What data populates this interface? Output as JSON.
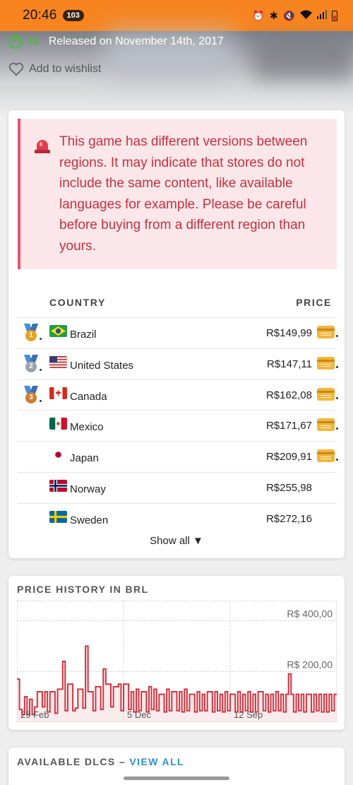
{
  "status_bar": {
    "time": "20:46",
    "notification_count": "103",
    "icons": [
      "alarm-icon",
      "bluetooth-icon",
      "mute-icon",
      "wifi-icon",
      "signal-icon",
      "battery-icon"
    ],
    "bg_color": "#f7841f"
  },
  "game": {
    "score": "76",
    "release_text": "Released on November 14th, 2017",
    "wishlist_label": "Add to wishlist"
  },
  "alert": {
    "text": "This game has different versions between regions. It may indicate that stores do not include the same content, like available languages for example. Please be careful before buying from a different region than yours.",
    "icon": "siren-icon",
    "color": "#c8303f"
  },
  "price_table": {
    "col_country": "COUNTRY",
    "col_price": "PRICE",
    "rows": [
      {
        "rank": "1",
        "medal_color": "#e8a21f",
        "flag": "brazil",
        "country": "Brazil",
        "price": "R$149,99",
        "card": true
      },
      {
        "rank": "2",
        "medal_color": "#9aa3ad",
        "flag": "united-states",
        "country": "United States",
        "price": "R$147,11",
        "card": true
      },
      {
        "rank": "3",
        "medal_color": "#d07a32",
        "flag": "canada",
        "country": "Canada",
        "price": "R$162,08",
        "card": true
      },
      {
        "rank": "",
        "flag": "mexico",
        "country": "Mexico",
        "price": "R$171,67",
        "card": true
      },
      {
        "rank": "",
        "flag": "japan",
        "country": "Japan",
        "price": "R$209,91",
        "card": true
      },
      {
        "rank": "",
        "flag": "norway",
        "country": "Norway",
        "price": "R$255,98",
        "card": false
      },
      {
        "rank": "",
        "flag": "sweden",
        "country": "Sweden",
        "price": "R$272,16",
        "card": false
      }
    ],
    "show_all": "Show all ▼"
  },
  "price_history": {
    "title": "PRICE HISTORY IN BRL"
  },
  "chart_data": {
    "type": "line",
    "x_tick_labels": [
      "29 Feb",
      "5 Dec",
      "12 Sep"
    ],
    "y_tick_labels": [
      "R$ 400,00",
      "R$ 200,00"
    ],
    "y_ticks": [
      400,
      200
    ],
    "ylim": [
      0,
      480
    ],
    "series": [
      {
        "color": "#d0343f",
        "values": [
          170,
          50,
          30,
          100,
          30,
          90,
          30,
          60,
          120,
          120,
          60,
          120,
          40,
          120,
          120,
          35,
          130,
          130,
          240,
          45,
          150,
          150,
          45,
          55,
          130,
          130,
          55,
          300,
          120,
          120,
          45,
          140,
          140,
          50,
          210,
          150,
          150,
          60,
          140,
          140,
          150,
          45,
          150,
          150,
          50,
          120,
          40,
          130,
          45,
          120,
          120,
          40,
          140,
          50,
          130,
          45,
          110,
          110,
          40,
          130,
          45,
          120,
          120,
          45,
          120,
          40,
          130,
          45,
          110,
          110,
          40,
          120,
          45,
          110,
          45,
          120,
          120,
          40,
          120,
          45,
          110,
          40,
          120,
          45,
          110,
          110,
          40,
          120,
          40,
          110,
          45,
          120,
          40,
          110,
          40,
          120,
          120,
          45,
          110,
          40,
          110,
          45,
          120,
          45,
          110,
          40,
          110,
          190,
          110,
          40,
          110,
          45,
          110,
          40,
          110,
          110,
          40,
          110,
          45,
          110,
          40,
          110,
          40,
          110,
          45,
          110
        ]
      }
    ],
    "fill_color": "#f4d3d6",
    "grid": true
  },
  "dlc": {
    "title": "AVAILABLE DLCS",
    "sep": " – ",
    "view_all": "VIEW ALL"
  }
}
